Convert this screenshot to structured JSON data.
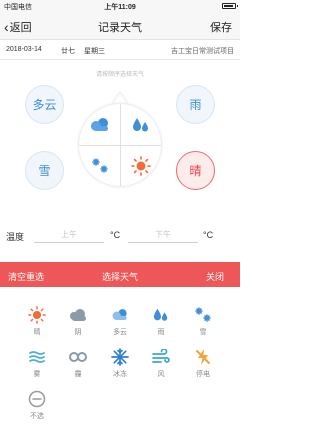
{
  "status_bar": {
    "carrier": "中国电信",
    "time": "上午11:09"
  },
  "nav": {
    "back_label": "返回",
    "title": "记录天气",
    "save_label": "保存"
  },
  "info": {
    "date": "2018-03-14",
    "lunar": "廿七",
    "weekday": "星期三",
    "project": "吉工宝日常测试项目"
  },
  "hint": "请按顺序选择天气",
  "picked": {
    "top_left": "多云",
    "top_right": "雨",
    "bottom_left": "雪",
    "bottom_right": "晴"
  },
  "wheel": {
    "quadrants": [
      "cloudy-icon",
      "rain-icon",
      "snow-icon",
      "sunny-icon"
    ]
  },
  "temperature": {
    "label": "温度",
    "high_placeholder": "上午",
    "low_placeholder": "下午",
    "unit": "°C"
  },
  "sheet": {
    "clear_label": "清空重选",
    "title": "选择天气",
    "close_label": "关闭"
  },
  "options": [
    {
      "label": "晴",
      "icon": "sunny-icon"
    },
    {
      "label": "阴",
      "icon": "overcast-icon"
    },
    {
      "label": "多云",
      "icon": "cloudy-icon"
    },
    {
      "label": "雨",
      "icon": "rain-icon"
    },
    {
      "label": "雪",
      "icon": "snow-icon"
    },
    {
      "label": "雾",
      "icon": "fog-icon"
    },
    {
      "label": "霾",
      "icon": "haze-icon"
    },
    {
      "label": "冰冻",
      "icon": "freeze-icon"
    },
    {
      "label": "风",
      "icon": "wind-icon"
    },
    {
      "label": "停电",
      "icon": "power-outage-icon"
    },
    {
      "label": "不选",
      "icon": "none-icon"
    }
  ],
  "colors": {
    "accent_red": "#ed5757",
    "accent_blue": "#3f8fd8",
    "sun_orange": "#f26b3a"
  }
}
